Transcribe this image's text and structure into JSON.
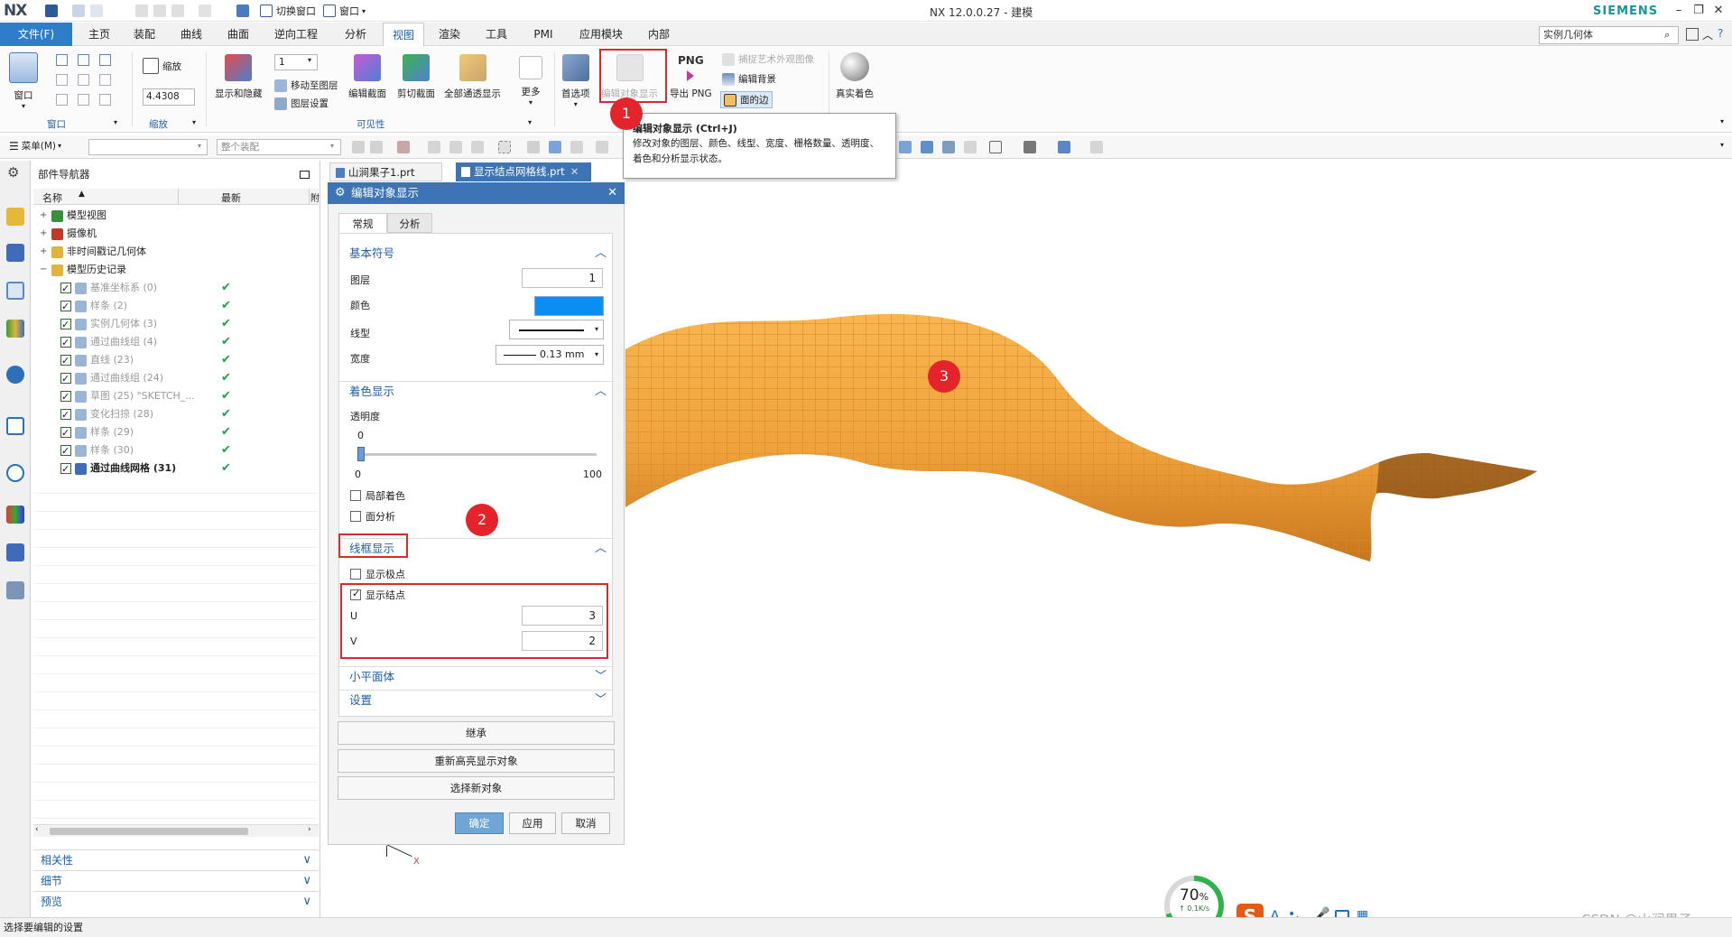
{
  "app": {
    "logo": "NX",
    "title": "NX 12.0.0.27 - 建模",
    "brand": "SIEMENS"
  },
  "quick_access": {
    "switch_window": "切换窗口",
    "window": "窗口"
  },
  "menu": {
    "file": "文件(F)",
    "tabs": [
      "主页",
      "装配",
      "曲线",
      "曲面",
      "逆向工程",
      "分析",
      "视图",
      "渲染",
      "工具",
      "PMI",
      "应用模块",
      "内部"
    ],
    "active_tab": "视图"
  },
  "search": {
    "value": "实例几何体"
  },
  "ribbon": {
    "window_btn": "窗口",
    "group_window": "窗口",
    "zoom_label": "缩放",
    "zoom_value": "4.4308",
    "group_zoom": "缩放",
    "show_hide": "显示和隐藏",
    "layer_value": "1",
    "move_to_layer": "移动至图层",
    "layer_settings": "图层设置",
    "edit_section": "编辑截面",
    "clip_section": "剪切截面",
    "all_pass": "全部通透显示",
    "more": "更多",
    "group_visibility": "可见性",
    "preferences": "首选项",
    "edit_obj_display": "编辑对象显示",
    "export_png": "导出 PNG",
    "png": "PNG",
    "capture_art": "捕捉艺术外观图像",
    "edit_background": "编辑背景",
    "face_edges": "面的边",
    "true_shading": "真实着色"
  },
  "toolbar": {
    "menu": "菜单(M)",
    "filter": "",
    "assembly": "整个装配"
  },
  "tooltip": {
    "title": "编辑对象显示 (Ctrl+J)",
    "body": "修改对象的图层、颜色、线型、宽度、栅格数量、透明度、着色和分析显示状态。"
  },
  "navigator": {
    "title": "部件导航器",
    "col_name": "名称",
    "col_latest": "最新",
    "col_extra": "附",
    "items": [
      {
        "label": "模型视图",
        "level": 0,
        "grey": false,
        "bold": false,
        "check": false
      },
      {
        "label": "摄像机",
        "level": 0,
        "grey": false,
        "bold": false,
        "check": false
      },
      {
        "label": "非时间戳记几何体",
        "level": 0,
        "grey": false,
        "bold": false,
        "check": false
      },
      {
        "label": "模型历史记录",
        "level": 0,
        "grey": false,
        "bold": false,
        "check": false
      },
      {
        "label": "基准坐标系 (0)",
        "level": 1,
        "grey": true,
        "bold": false,
        "check": true
      },
      {
        "label": "样条 (2)",
        "level": 1,
        "grey": true,
        "bold": false,
        "check": true
      },
      {
        "label": "实例几何体 (3)",
        "level": 1,
        "grey": true,
        "bold": false,
        "check": true
      },
      {
        "label": "通过曲线组 (4)",
        "level": 1,
        "grey": true,
        "bold": false,
        "check": true
      },
      {
        "label": "直线 (23)",
        "level": 1,
        "grey": true,
        "bold": false,
        "check": true
      },
      {
        "label": "通过曲线组 (24)",
        "level": 1,
        "grey": true,
        "bold": false,
        "check": true
      },
      {
        "label": "草图 (25) \"SKETCH_...",
        "level": 1,
        "grey": true,
        "bold": false,
        "check": true
      },
      {
        "label": "变化扫掠 (28)",
        "level": 1,
        "grey": true,
        "bold": false,
        "check": true
      },
      {
        "label": "样条 (29)",
        "level": 1,
        "grey": true,
        "bold": false,
        "check": true
      },
      {
        "label": "样条 (30)",
        "level": 1,
        "grey": true,
        "bold": false,
        "check": true
      },
      {
        "label": "通过曲线网格 (31)",
        "level": 1,
        "grey": false,
        "bold": true,
        "check": true
      }
    ],
    "accordions": [
      "相关性",
      "细节",
      "预览"
    ]
  },
  "file_tabs": [
    {
      "label": "山涧果子1.prt",
      "active": false
    },
    {
      "label": "显示结点网格线.prt",
      "active": true
    }
  ],
  "dialog": {
    "title": "编辑对象显示",
    "tabs": [
      "常规",
      "分析"
    ],
    "sect_basic": "基本符号",
    "layer_label": "图层",
    "layer_value": "1",
    "color_label": "颜色",
    "color_hex": "#0a8ef2",
    "linetype_label": "线型",
    "width_label": "宽度",
    "width_value": "0.13 mm",
    "sect_shading": "着色显示",
    "transparency_label": "透明度",
    "transparency_value": "0",
    "slider_min": "0",
    "slider_max": "100",
    "slider_fraction": 0,
    "partial_shading": "局部着色",
    "face_analysis": "面分析",
    "sect_wire": "线框显示",
    "show_poles": "显示极点",
    "show_knots": "显示结点",
    "u_label": "U",
    "u_value": "3",
    "v_label": "V",
    "v_value": "2",
    "sect_facet": "小平面体",
    "sect_settings": "设置",
    "inherit": "继承",
    "rehighlight": "重新高亮显示对象",
    "select_new": "选择新对象",
    "ok": "确定",
    "apply": "应用",
    "cancel": "取消"
  },
  "callouts": [
    "1",
    "2",
    "3"
  ],
  "viewport": {
    "surface_color": "#f4a23a",
    "triad_label": "X"
  },
  "tray": {
    "percent": "70",
    "percent_unit": "%",
    "speed": "↑ 0.1K/s",
    "ime_letter": "A"
  },
  "watermark": "CSDN @山涧果子",
  "status": "选择要编辑的设置"
}
